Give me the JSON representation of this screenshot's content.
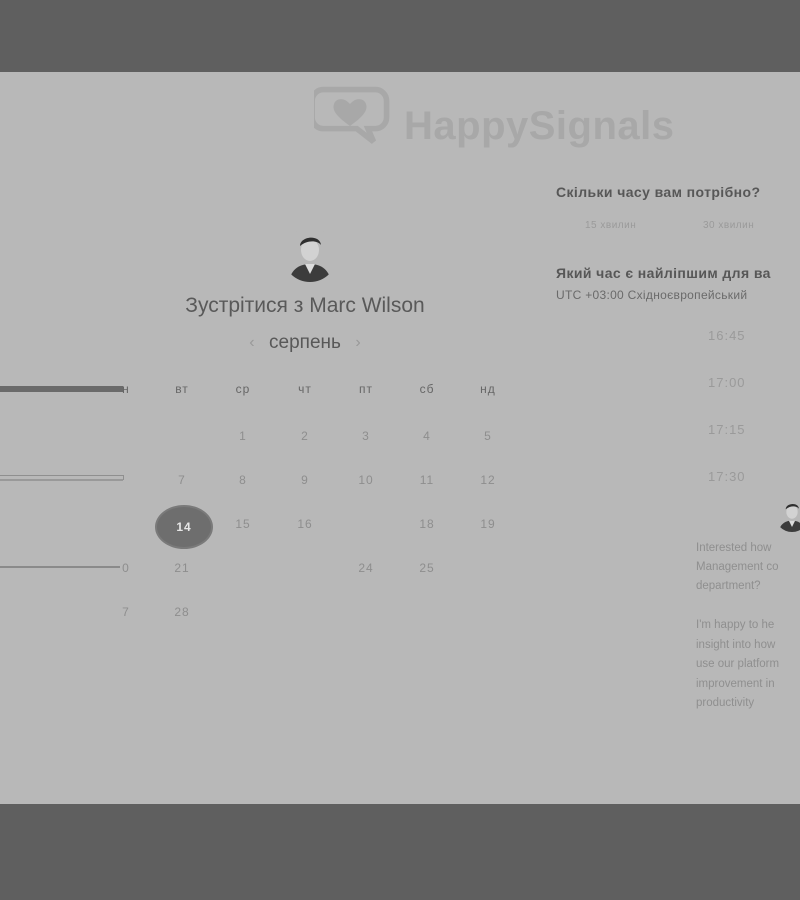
{
  "brand": {
    "name": "HappySignals"
  },
  "host": {
    "meet_title": "Зустрітися з Marc Wilson",
    "avatar_icon": "person-avatar-icon"
  },
  "calendar": {
    "month": "серпень",
    "weekdays": [
      "вт",
      "ср",
      "чт",
      "пт",
      "сб",
      "нд"
    ],
    "partial_weekday": "н",
    "rows": [
      [
        "",
        "1",
        "2",
        "3",
        "4",
        "5"
      ],
      [
        "7",
        "8",
        "9",
        "10",
        "11",
        "12"
      ],
      [
        "14",
        "15",
        "16",
        "",
        "18",
        "19"
      ],
      [
        "21",
        "",
        "",
        "24",
        "25",
        ""
      ],
      [
        "28",
        "",
        "",
        "",
        "",
        ""
      ]
    ],
    "partial_column": [
      "",
      "",
      "",
      "0",
      "7"
    ],
    "selected_day": "14"
  },
  "duration": {
    "question": "Скільки часу вам потрібно?",
    "options": [
      "15 хвилин",
      "30 хвилин"
    ]
  },
  "time": {
    "question": "Який час є найліпшим для ва",
    "timezone": "UTC +03:00 Східноєвропейський",
    "slots": [
      "16:45",
      "17:00",
      "17:15",
      "17:30"
    ]
  },
  "bio": {
    "lines": [
      "Interested how",
      "Management co",
      "department?",
      "",
      "I'm happy to he",
      "insight into how",
      "use our platform",
      "improvement in",
      "productivity"
    ]
  }
}
